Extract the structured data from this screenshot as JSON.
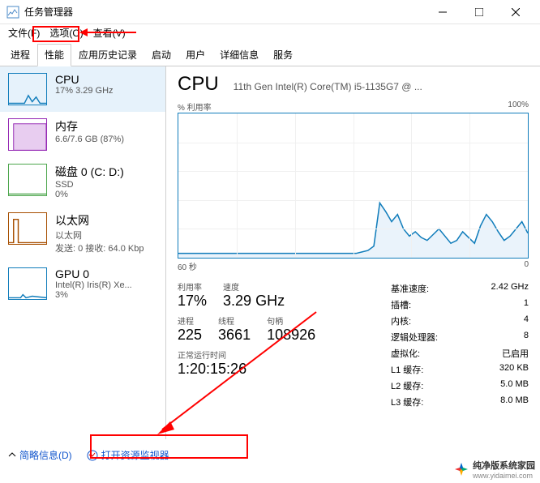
{
  "window": {
    "title": "任务管理器"
  },
  "menu": {
    "file": "文件(F)",
    "options": "选项(O)",
    "view": "查看(V)"
  },
  "tabs": {
    "processes": "进程",
    "performance": "性能",
    "history": "应用历史记录",
    "startup": "启动",
    "users": "用户",
    "details": "详细信息",
    "services": "服务"
  },
  "sidebar": {
    "cpu": {
      "name": "CPU",
      "sub": "17% 3.29 GHz"
    },
    "mem": {
      "name": "内存",
      "sub": "6.6/7.6 GB (87%)"
    },
    "disk": {
      "name": "磁盘 0 (C: D:)",
      "sub1": "SSD",
      "sub2": "0%"
    },
    "eth": {
      "name": "以太网",
      "sub1": "以太网",
      "sub2": "发送: 0 接收: 64.0 Kbp"
    },
    "gpu": {
      "name": "GPU 0",
      "sub1": "Intel(R) Iris(R) Xe...",
      "sub2": "3%"
    }
  },
  "main": {
    "title": "CPU",
    "subtitle": "11th Gen Intel(R) Core(TM) i5-1135G7 @ ...",
    "chart_top_left": "% 利用率",
    "chart_top_right": "100%",
    "chart_bottom_left": "60 秒",
    "chart_bottom_right": "0",
    "stats": {
      "util_lbl": "利用率",
      "util_val": "17%",
      "speed_lbl": "速度",
      "speed_val": "3.29 GHz",
      "proc_lbl": "进程",
      "proc_val": "225",
      "thr_lbl": "线程",
      "thr_val": "3661",
      "hnd_lbl": "句柄",
      "hnd_val": "108926",
      "uptime_lbl": "正常运行时间",
      "uptime_val": "1:20:15:26"
    },
    "right": {
      "base_lbl": "基准速度:",
      "base_val": "2.42 GHz",
      "sockets_lbl": "插槽:",
      "sockets_val": "1",
      "cores_lbl": "内核:",
      "cores_val": "4",
      "lproc_lbl": "逻辑处理器:",
      "lproc_val": "8",
      "virt_lbl": "虚拟化:",
      "virt_val": "已启用",
      "l1_lbl": "L1 缓存:",
      "l1_val": "320 KB",
      "l2_lbl": "L2 缓存:",
      "l2_val": "5.0 MB",
      "l3_lbl": "L3 缓存:",
      "l3_val": "8.0 MB"
    }
  },
  "footer": {
    "fewer": "简略信息(D)",
    "resmon": "打开资源监视器"
  },
  "brand": {
    "name": "纯净版系统家园",
    "url": "www.yidaimei.com"
  },
  "chart_data": {
    "type": "line",
    "title": "% 利用率",
    "xlabel": "60 秒 → 0",
    "ylabel": "% 利用率",
    "ylim": [
      0,
      100
    ],
    "xlim": [
      60,
      0
    ],
    "values": [
      3,
      3,
      3,
      3,
      3,
      3,
      3,
      3,
      3,
      3,
      3,
      3,
      3,
      3,
      3,
      3,
      3,
      3,
      3,
      3,
      3,
      3,
      3,
      3,
      3,
      3,
      3,
      3,
      3,
      3,
      3,
      4,
      5,
      8,
      38,
      32,
      25,
      30,
      20,
      15,
      18,
      14,
      12,
      16,
      20,
      15,
      10,
      12,
      18,
      14,
      10,
      22,
      30,
      25,
      18,
      12,
      15,
      20,
      25,
      17
    ]
  }
}
